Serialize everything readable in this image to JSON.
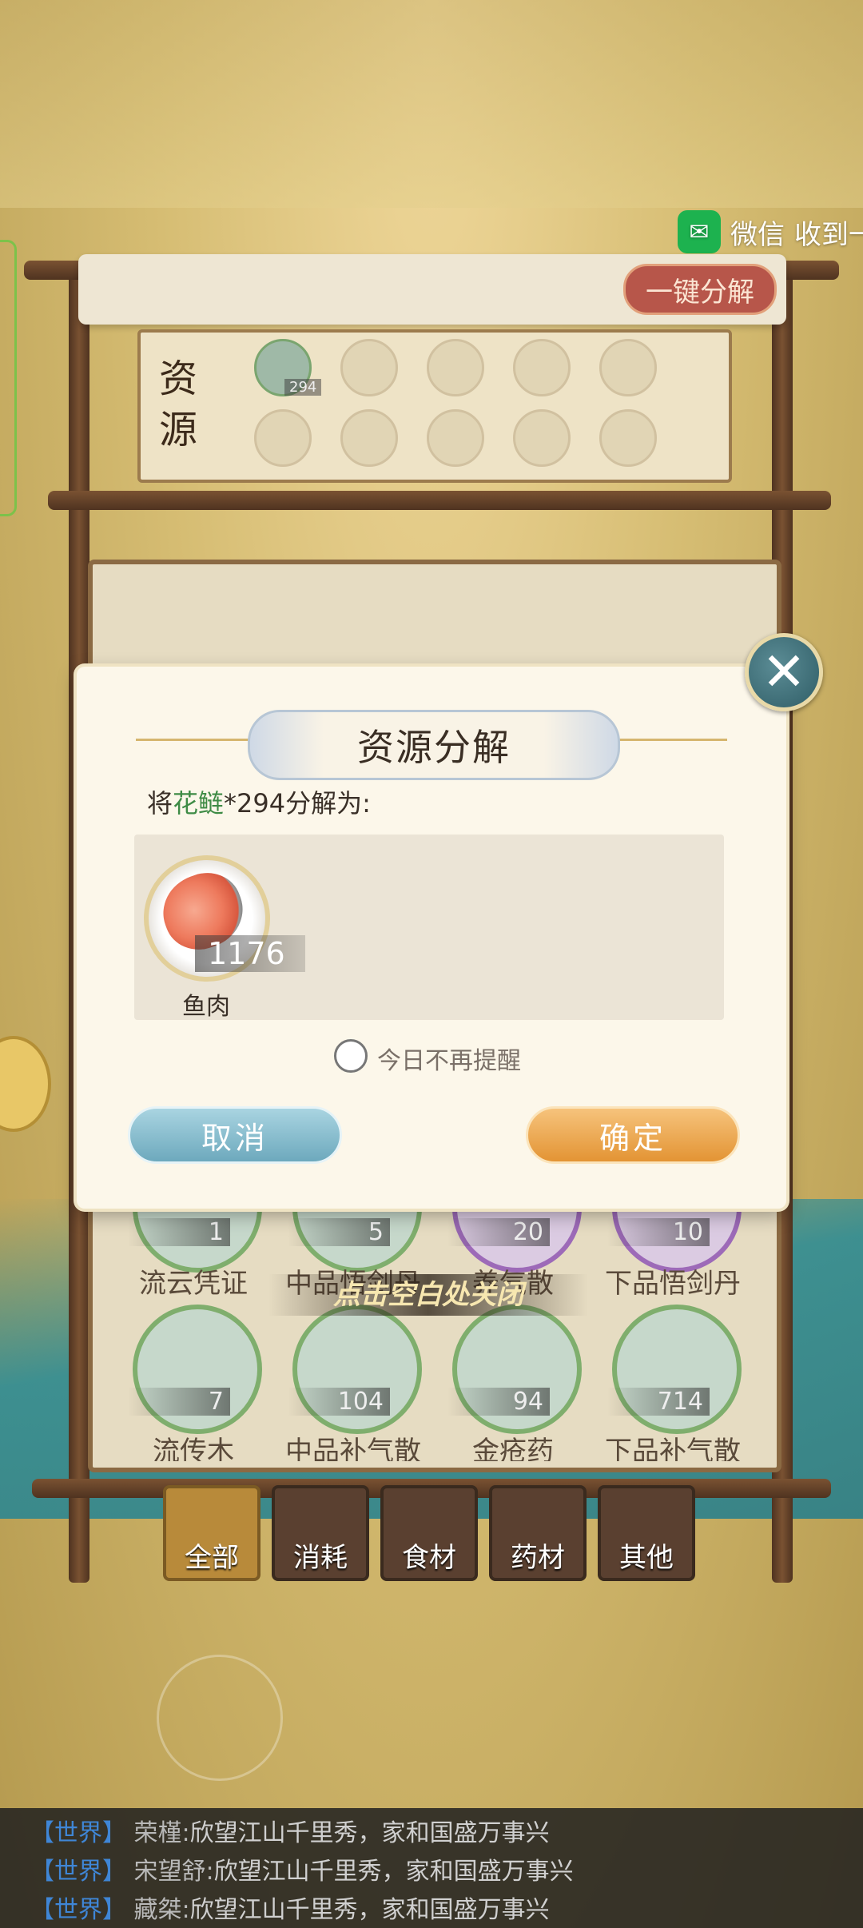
{
  "notification": {
    "app": "微信",
    "text": "收到一"
  },
  "board": {
    "onekey_label": "一键分解",
    "resource_label_line1": "资",
    "resource_label_line2": "源",
    "slot_count": "294",
    "items_row1": [
      {
        "count": "1",
        "name": "流云凭证"
      },
      {
        "count": "5",
        "name": "中品悟剑丹"
      },
      {
        "count": "20",
        "name": "养气散"
      },
      {
        "count": "10",
        "name": "下品悟剑丹"
      }
    ],
    "items_row2": [
      {
        "count": "7",
        "name": "流传木"
      },
      {
        "count": "104",
        "name": "中品补气散"
      },
      {
        "count": "94",
        "name": "金疮药"
      },
      {
        "count": "714",
        "name": "下品补气散"
      }
    ],
    "close_hint": "点击空白处关闭"
  },
  "tabs": [
    {
      "label": "全部",
      "active": true
    },
    {
      "label": "消耗",
      "active": false
    },
    {
      "label": "食材",
      "active": false
    },
    {
      "label": "药材",
      "active": false
    },
    {
      "label": "其他",
      "active": false
    }
  ],
  "dialog": {
    "title": "资源分解",
    "desc_prefix": "将",
    "desc_item": "花鲢",
    "desc_suffix": "*294分解为:",
    "reward": {
      "count": "1176",
      "name": "鱼肉"
    },
    "checkbox_label": "今日不再提醒",
    "cancel_label": "取消",
    "ok_label": "确定",
    "close_icon": "close-icon"
  },
  "chat": [
    {
      "channel": "【世界】",
      "user": "荣槿:",
      "message": "欣望江山千里秀，家和国盛万事兴"
    },
    {
      "channel": "【世界】",
      "user": "宋望舒:",
      "message": "欣望江山千里秀，家和国盛万事兴"
    },
    {
      "channel": "【世界】",
      "user": "藏桀:",
      "message": "欣望江山千里秀，家和国盛万事兴"
    }
  ]
}
